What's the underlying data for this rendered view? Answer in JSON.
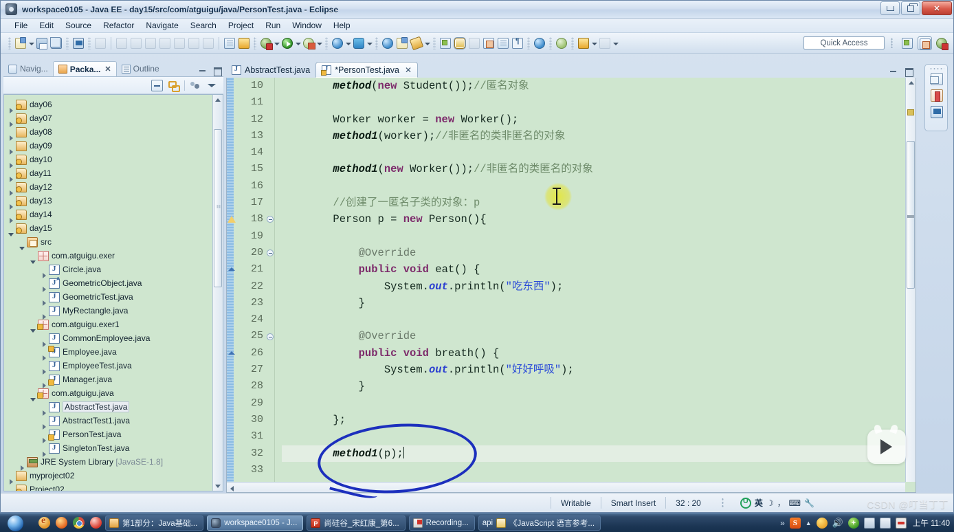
{
  "window": {
    "title": "workspace0105 - Java EE - day15/src/com/atguigu/java/PersonTest.java - Eclipse",
    "minimize_label": "",
    "restore_label": "",
    "close_label": "✕"
  },
  "menubar": {
    "items": [
      "File",
      "Edit",
      "Source",
      "Refactor",
      "Navigate",
      "Search",
      "Project",
      "Run",
      "Window",
      "Help"
    ]
  },
  "toolbar": {
    "quick_access_placeholder": "Quick Access",
    "icons": [
      "new-wizard",
      "save",
      "save-all",
      "console",
      "skip-breakpoints",
      "run-last",
      "pause",
      "terminate",
      "step-over",
      "step-return",
      "step-into",
      "back",
      "forward",
      "next-annotation",
      "previous-annotation",
      "external-tools",
      "debug",
      "run",
      "run-server",
      "new-java-project",
      "new-java-class",
      "search",
      "open-type",
      "open-task",
      "pin-editor",
      "toggle-markoccurrences",
      "link",
      "open-resource",
      "outline",
      "format",
      "web-browser",
      "profile",
      "download"
    ]
  },
  "left_view": {
    "tabs": [
      {
        "label": "Navig...",
        "icon": "navigator-icon",
        "active": false,
        "closable": false
      },
      {
        "label": "Packa...",
        "icon": "package-explorer-icon",
        "active": true,
        "closable": true
      },
      {
        "label": "Outline",
        "icon": "outline-icon",
        "active": false,
        "closable": false
      }
    ],
    "toolbar_icons": [
      "collapse-all-icon",
      "link-with-editor-icon",
      "focus-on-active-task-icon",
      "view-menu-icon"
    ],
    "panel_buttons": [
      "minimize-icon",
      "maximize-icon"
    ],
    "tree": [
      {
        "indent": 0,
        "twist": "closed",
        "icon": "project-java-icon",
        "label": "day06"
      },
      {
        "indent": 0,
        "twist": "closed",
        "icon": "project-java-icon",
        "label": "day07"
      },
      {
        "indent": 0,
        "twist": "closed",
        "icon": "project-plain-icon",
        "label": "day08"
      },
      {
        "indent": 0,
        "twist": "closed",
        "icon": "project-plain-icon",
        "label": "day09"
      },
      {
        "indent": 0,
        "twist": "closed",
        "icon": "project-java-icon",
        "label": "day10"
      },
      {
        "indent": 0,
        "twist": "closed",
        "icon": "project-java-icon",
        "label": "day11"
      },
      {
        "indent": 0,
        "twist": "closed",
        "icon": "project-java-icon",
        "label": "day12"
      },
      {
        "indent": 0,
        "twist": "closed",
        "icon": "project-java-icon",
        "label": "day13"
      },
      {
        "indent": 0,
        "twist": "closed",
        "icon": "project-java-icon",
        "label": "day14"
      },
      {
        "indent": 0,
        "twist": "open",
        "icon": "project-java-icon",
        "label": "day15"
      },
      {
        "indent": 1,
        "twist": "open",
        "icon": "source-folder-icon",
        "label": "src"
      },
      {
        "indent": 2,
        "twist": "open",
        "icon": "package-icon",
        "label": "com.atguigu.exer"
      },
      {
        "indent": 3,
        "twist": "closed",
        "icon": "java-file-icon",
        "label": "Circle.java"
      },
      {
        "indent": 3,
        "twist": "closed",
        "icon": "java-abstract-file-icon",
        "label": "GeometricObject.java"
      },
      {
        "indent": 3,
        "twist": "closed",
        "icon": "java-file-icon",
        "label": "GeometricTest.java"
      },
      {
        "indent": 3,
        "twist": "closed",
        "icon": "java-file-icon",
        "label": "MyRectangle.java"
      },
      {
        "indent": 2,
        "twist": "open",
        "icon": "package-locked-icon",
        "label": "com.atguigu.exer1"
      },
      {
        "indent": 3,
        "twist": "closed",
        "icon": "java-file-icon",
        "label": "CommonEmployee.java"
      },
      {
        "indent": 3,
        "twist": "closed",
        "icon": "java-abstract-locked-icon",
        "label": "Employee.java"
      },
      {
        "indent": 3,
        "twist": "closed",
        "icon": "java-file-icon",
        "label": "EmployeeTest.java"
      },
      {
        "indent": 3,
        "twist": "closed",
        "icon": "java-locked-file-icon",
        "label": "Manager.java"
      },
      {
        "indent": 2,
        "twist": "open",
        "icon": "package-locked-icon",
        "label": "com.atguigu.java"
      },
      {
        "indent": 3,
        "twist": "closed",
        "icon": "java-file-icon",
        "label": "AbstractTest.java",
        "selected": true
      },
      {
        "indent": 3,
        "twist": "closed",
        "icon": "java-file-icon",
        "label": "AbstractTest1.java"
      },
      {
        "indent": 3,
        "twist": "closed",
        "icon": "java-locked-file-icon",
        "label": "PersonTest.java"
      },
      {
        "indent": 3,
        "twist": "closed",
        "icon": "java-file-icon",
        "label": "SingletonTest.java"
      },
      {
        "indent": 1,
        "twist": "closed",
        "icon": "jre-library-icon",
        "label": "JRE System Library",
        "suffix": " [JavaSE-1.8]"
      },
      {
        "indent": 0,
        "twist": "closed",
        "icon": "project-plain-icon",
        "label": "myproject02"
      },
      {
        "indent": 0,
        "twist": "closed",
        "icon": "project-java-icon",
        "label": "Project02"
      }
    ]
  },
  "editor": {
    "tabs": [
      {
        "label": "AbstractTest.java",
        "active": false,
        "dirty": false,
        "locked": false
      },
      {
        "label": "*PersonTest.java",
        "active": true,
        "dirty": true,
        "locked": true
      }
    ],
    "first_line": 10,
    "lines": [
      {
        "n": 10,
        "fold": false,
        "marker": "",
        "tokens": [
          {
            "t": "        ",
            "c": ""
          },
          {
            "t": "method",
            "c": "mth"
          },
          {
            "t": "(",
            "c": ""
          },
          {
            "t": "new",
            "c": "k"
          },
          {
            "t": " Student());",
            "c": ""
          },
          {
            "t": "//匿名对象",
            "c": "cmt"
          }
        ]
      },
      {
        "n": 11,
        "fold": false,
        "marker": "",
        "tokens": []
      },
      {
        "n": 12,
        "fold": false,
        "marker": "",
        "tokens": [
          {
            "t": "        Worker worker = ",
            "c": ""
          },
          {
            "t": "new",
            "c": "k"
          },
          {
            "t": " Worker();",
            "c": ""
          }
        ]
      },
      {
        "n": 13,
        "fold": false,
        "marker": "",
        "tokens": [
          {
            "t": "        ",
            "c": ""
          },
          {
            "t": "method1",
            "c": "mth"
          },
          {
            "t": "(worker);",
            "c": ""
          },
          {
            "t": "//非匿名的类非匿名的对象",
            "c": "cmt"
          }
        ]
      },
      {
        "n": 14,
        "fold": false,
        "marker": "",
        "tokens": []
      },
      {
        "n": 15,
        "fold": false,
        "marker": "",
        "tokens": [
          {
            "t": "        ",
            "c": ""
          },
          {
            "t": "method1",
            "c": "mth"
          },
          {
            "t": "(",
            "c": ""
          },
          {
            "t": "new",
            "c": "k"
          },
          {
            "t": " Worker());",
            "c": ""
          },
          {
            "t": "//非匿名的类匿名的对象",
            "c": "cmt"
          }
        ]
      },
      {
        "n": 16,
        "fold": false,
        "marker": "",
        "tokens": []
      },
      {
        "n": 17,
        "fold": false,
        "marker": "",
        "tokens": [
          {
            "t": "        ",
            "c": ""
          },
          {
            "t": "//创建了一匿名子类的对象：p",
            "c": "cmt"
          }
        ]
      },
      {
        "n": 18,
        "fold": true,
        "marker": "warning",
        "tokens": [
          {
            "t": "        Person p = ",
            "c": ""
          },
          {
            "t": "new",
            "c": "k"
          },
          {
            "t": " Person(){",
            "c": ""
          }
        ]
      },
      {
        "n": 19,
        "fold": false,
        "marker": "",
        "tokens": []
      },
      {
        "n": 20,
        "fold": true,
        "marker": "",
        "tokens": [
          {
            "t": "            ",
            "c": ""
          },
          {
            "t": "@Override",
            "c": "ann"
          }
        ]
      },
      {
        "n": 21,
        "fold": false,
        "marker": "override",
        "tokens": [
          {
            "t": "            ",
            "c": ""
          },
          {
            "t": "public",
            "c": "k"
          },
          {
            "t": " ",
            "c": ""
          },
          {
            "t": "void",
            "c": "k"
          },
          {
            "t": " eat() {",
            "c": ""
          }
        ]
      },
      {
        "n": 22,
        "fold": false,
        "marker": "",
        "tokens": [
          {
            "t": "                System.",
            "c": ""
          },
          {
            "t": "out",
            "c": "fld"
          },
          {
            "t": ".println(",
            "c": ""
          },
          {
            "t": "\"吃东西\"",
            "c": "str"
          },
          {
            "t": ");",
            "c": ""
          }
        ]
      },
      {
        "n": 23,
        "fold": false,
        "marker": "",
        "tokens": [
          {
            "t": "            }",
            "c": ""
          }
        ]
      },
      {
        "n": 24,
        "fold": false,
        "marker": "",
        "tokens": []
      },
      {
        "n": 25,
        "fold": true,
        "marker": "",
        "tokens": [
          {
            "t": "            ",
            "c": ""
          },
          {
            "t": "@Override",
            "c": "ann"
          }
        ]
      },
      {
        "n": 26,
        "fold": false,
        "marker": "override",
        "tokens": [
          {
            "t": "            ",
            "c": ""
          },
          {
            "t": "public",
            "c": "k"
          },
          {
            "t": " ",
            "c": ""
          },
          {
            "t": "void",
            "c": "k"
          },
          {
            "t": " breath() {",
            "c": ""
          }
        ]
      },
      {
        "n": 27,
        "fold": false,
        "marker": "",
        "tokens": [
          {
            "t": "                System.",
            "c": ""
          },
          {
            "t": "out",
            "c": "fld"
          },
          {
            "t": ".println(",
            "c": ""
          },
          {
            "t": "\"好好呼吸\"",
            "c": "str"
          },
          {
            "t": ");",
            "c": ""
          }
        ]
      },
      {
        "n": 28,
        "fold": false,
        "marker": "",
        "tokens": [
          {
            "t": "            }",
            "c": ""
          }
        ]
      },
      {
        "n": 29,
        "fold": false,
        "marker": "",
        "tokens": []
      },
      {
        "n": 30,
        "fold": false,
        "marker": "",
        "tokens": [
          {
            "t": "        };",
            "c": ""
          }
        ]
      },
      {
        "n": 31,
        "fold": false,
        "marker": "",
        "tokens": []
      },
      {
        "n": 32,
        "fold": false,
        "marker": "",
        "current": true,
        "caret": true,
        "tokens": [
          {
            "t": "        ",
            "c": ""
          },
          {
            "t": "method1",
            "c": "mth"
          },
          {
            "t": "(p);",
            "c": ""
          }
        ]
      },
      {
        "n": 33,
        "fold": false,
        "marker": "",
        "tokens": []
      }
    ],
    "annotation": {
      "shape": "hand-drawn-ellipse",
      "color": "#1c2fbd",
      "targets_line": 32
    }
  },
  "right_bar": {
    "icons": [
      "restore-icon",
      "problems-icon",
      "console-icon"
    ]
  },
  "statusbar": {
    "writable": "Writable",
    "insert_mode": "Smart Insert",
    "position": "32 : 20"
  },
  "ime": {
    "logo": "sogou-u-icon",
    "mode": "英",
    "moon": "☽",
    "punct": "，",
    "keyboard": "⌨",
    "tool": "🔧"
  },
  "taskbar": {
    "start": "start-orb-icon",
    "quicklaunch": [
      "ie-icon",
      "firefox-icon",
      "chrome-icon",
      "opera-icon"
    ],
    "items": [
      {
        "label": "第1部分：Java基础...",
        "icon": "folder-icon",
        "active": false
      },
      {
        "label": "workspace0105 - J...",
        "icon": "eclipse-icon",
        "active": true
      },
      {
        "label": "尚硅谷_宋红康_第6...",
        "icon": "powerpoint-icon",
        "active": false
      },
      {
        "label": "Recording...",
        "icon": "recorder-icon",
        "active": false
      },
      {
        "label": "《JavaScript 语言参考...",
        "icon": "api-icon",
        "prefix": "api",
        "active": false
      }
    ],
    "tray_overflow": "»",
    "tray": [
      "sogou-icon",
      "show-hidden-icon",
      "weather-icon",
      "volume-icon",
      "security-icon",
      "network-icon",
      "monitor-icon",
      "blocked-icon"
    ],
    "clock": "上午 11:40"
  },
  "watermark": "CSDN @叮当丁丁"
}
